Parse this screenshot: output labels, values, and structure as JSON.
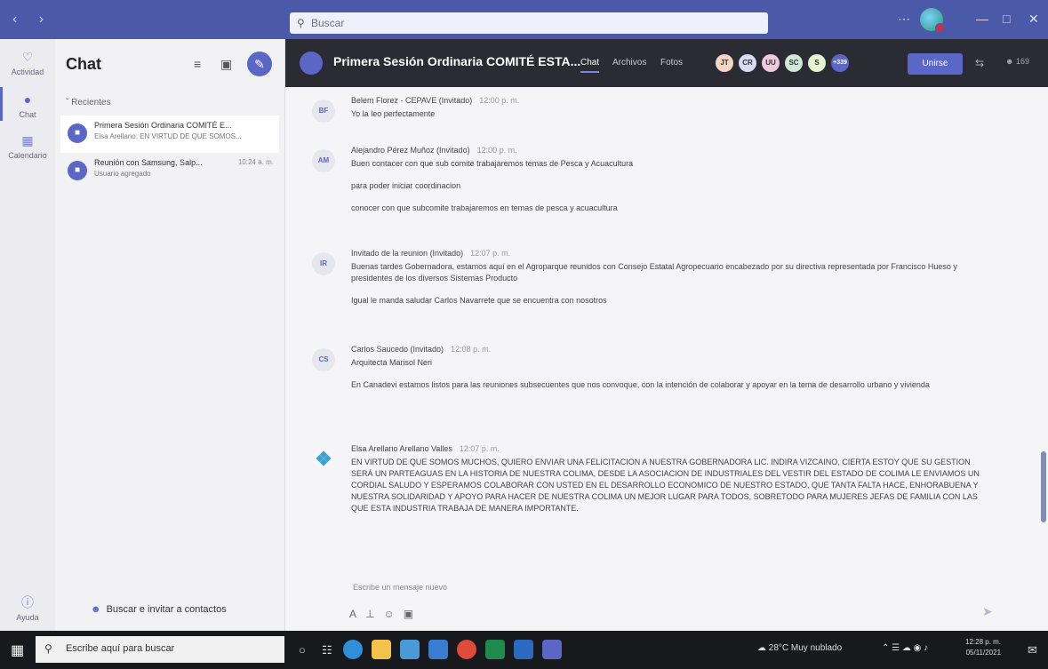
{
  "titlebar": {
    "search_placeholder": "Buscar",
    "nav": "‹ ›"
  },
  "rail": [
    {
      "label": "Actividad",
      "icon": "bell-icon"
    },
    {
      "label": "Chat",
      "icon": "chat-icon"
    },
    {
      "label": "Calendario",
      "icon": "calendar-icon"
    },
    {
      "label": "Ayuda",
      "icon": "help-icon"
    }
  ],
  "chat_list": {
    "title": "Chat",
    "section": "Recientes",
    "items": [
      {
        "title": "Primera Sesión Ordinaria COMITÉ E...",
        "preview": "Elsa Arellano: EN VIRTUD DE QUE SOMOS...",
        "time": ""
      },
      {
        "title": "Reunión con Samsung, Salp...",
        "preview": "Usuario agregado",
        "time": "10:24 a. m."
      }
    ],
    "invite": "Buscar e invitar a contactos"
  },
  "conversation": {
    "title": "Primera Sesión Ordinaria COMITÉ ESTA...",
    "tabs": [
      "Chat",
      "Archivos",
      "Fotos"
    ],
    "participants": [
      {
        "initials": "JT",
        "color": "#f3d7c4"
      },
      {
        "initials": "CR",
        "color": "#d9dcf7"
      },
      {
        "initials": "UU",
        "color": "#f0c9dc"
      },
      {
        "initials": "SC",
        "color": "#cfe8d8"
      },
      {
        "initials": "S",
        "color": "#e5f3cf"
      },
      {
        "initials": "+339",
        "color": "#5b67c7"
      }
    ],
    "join_label": "Unirse",
    "people_count": "169"
  },
  "messages": [
    {
      "initials": "BF",
      "author": "Belem Florez - CEPAVE (Invitado)",
      "time": "12:00 p. m.",
      "lines": [
        "Yo la leo perfectamente"
      ]
    },
    {
      "initials": "AM",
      "author": "Alejandro Pérez Muñoz (Invitado)",
      "time": "12:00 p. m.",
      "lines": [
        "Buen contacer con que sub comite trabajaremos temas de Pesca y Acuacultura",
        "para poder iniciar coordinacion",
        "conocer con que subcomite trabajaremos en temas de pesca y acuacultura"
      ]
    },
    {
      "initials": "IR",
      "author": "Invitado de la reunion (Invitado)",
      "time": "12:07 p. m.",
      "lines": [
        "Buenas tardes Gobernadora, estamos aquí en el Agroparque reunidos con Consejo Estatal Agropecuario encabezado por su directiva representada por Francisco Hueso y presidentes de los diversos Sistemas Producto",
        "Igual le manda saludar Carlos Navarrete que se encuentra con nosotros"
      ]
    },
    {
      "initials": "CS",
      "author": "Carlos Saucedo (Invitado)",
      "time": "12:08 p. m.",
      "lines": [
        "Arquitecta Marisol Neri",
        "En Canadevi estamos listos para las reuniones subsecuentes que nos convoque, con la intención de colaborar y apoyar en la tema de desarrollo urbano y vivienda"
      ]
    },
    {
      "initials": "",
      "author": "Elsa Arellano Arellano Valles",
      "time": "12:07 p. m.",
      "lines": [
        "EN VIRTUD DE QUE SOMOS MUCHOS, QUIERO ENVIAR UNA FELICITACION A NUESTRA GOBERNADORA LIC. INDIRA VIZCAINO, CIERTA ESTOY QUE SU GESTION SERÁ UN PARTEAGUAS EN LA HISTORIA DE NUESTRA COLIMA, DESDE LA ASOCIACION DE INDUSTRIALES DEL VESTIR DEL ESTADO DE COLIMA LE ENVIAMOS UN CORDIAL SALUDO Y ESPERAMOS COLABORAR CON USTED EN EL DESARROLLO ECONOMICO DE NUESTRO ESTADO, QUE TANTA FALTA HACE, ENHORABUENA Y NUESTRA SOLIDARIDAD Y APOYO PARA HACER DE NUESTRA COLIMA UN MEJOR LUGAR PARA TODOS, SOBRETODO PARA MUJERES JEFAS DE FAMILIA CON LAS QUE ESTA INDUSTRIA TRABAJA DE MANERA IMPORTANTE."
      ]
    }
  ],
  "compose": {
    "placeholder": "Escribe un mensaje nuevo"
  },
  "taskbar": {
    "search_placeholder": "Escribe aquí para buscar",
    "weather": "28°C Muy nublado",
    "time": "12:28 p. m.",
    "date": "05/11/2021",
    "apps": [
      {
        "name": "edge",
        "color": "#2f8fd8"
      },
      {
        "name": "files",
        "color": "#f2c24b"
      },
      {
        "name": "store",
        "color": "#4b9ad8"
      },
      {
        "name": "mail",
        "color": "#3a7dd0"
      },
      {
        "name": "chrome",
        "color": "#e04a3a"
      },
      {
        "name": "excel",
        "color": "#1e8a4c"
      },
      {
        "name": "word",
        "color": "#2c6ac0"
      },
      {
        "name": "teams",
        "color": "#5b67c7"
      }
    ]
  }
}
